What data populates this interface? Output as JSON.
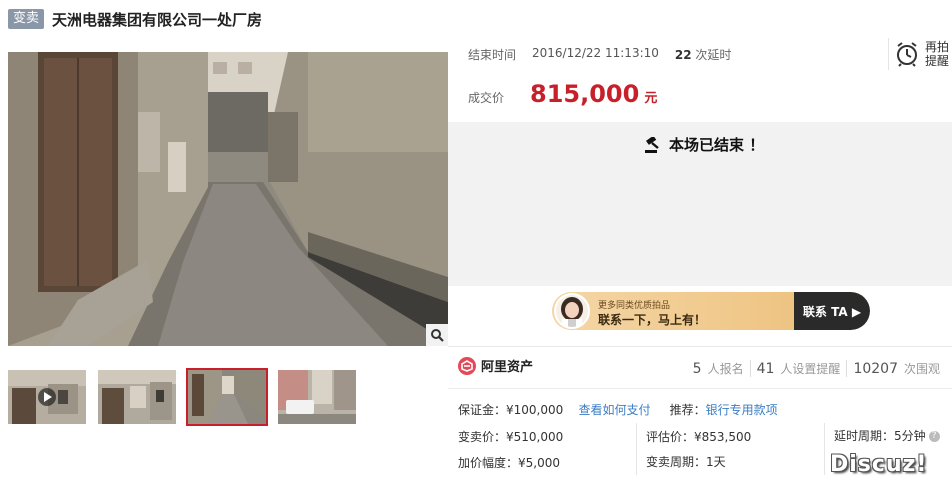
{
  "header": {
    "tag": "变卖",
    "title": "天洲电器集团有限公司一处厂房"
  },
  "auction": {
    "end_label": "结束时间",
    "end_time": "2016/12/22 11:13:10",
    "delay_count": "22",
    "delay_label": "次延时",
    "remind_label": "再拍提醒",
    "deal_price_label": "成交价",
    "deal_price": "815,000",
    "deal_price_unit": "元",
    "ended_text": "本场已结束 ！"
  },
  "banner": {
    "line1": "更多同类优质拍品",
    "line2": "联系一下，马上有！",
    "button": "联系 TA ▶"
  },
  "brand": {
    "name": "阿里资产"
  },
  "stats": [
    {
      "num": "5",
      "label": "人报名"
    },
    {
      "num": "41",
      "label": "人设置提醒"
    },
    {
      "num": "10207",
      "label": "次围观"
    }
  ],
  "details": {
    "deposit_label": "保证金：",
    "deposit_value": "¥100,000",
    "deposit_link": "查看如何支付",
    "recommend_label": "推荐：",
    "recommend_link": "银行专用款项",
    "sale_price_label": "变卖价：",
    "sale_price_value": "¥510,000",
    "eval_price_label": "评估价：",
    "eval_price_value": "¥853,500",
    "delay_period_label": "延时周期：",
    "delay_period_value": "5分钟",
    "increment_label": "加价幅度：",
    "increment_value": "¥5,000",
    "sale_period_label": "变卖周期：",
    "sale_period_value": "1天"
  },
  "watermark": "Discuz!",
  "colors": {
    "accent_red": "#c8202b",
    "link_blue": "#3b7dc4",
    "tag_gray": "#8a97a8"
  }
}
